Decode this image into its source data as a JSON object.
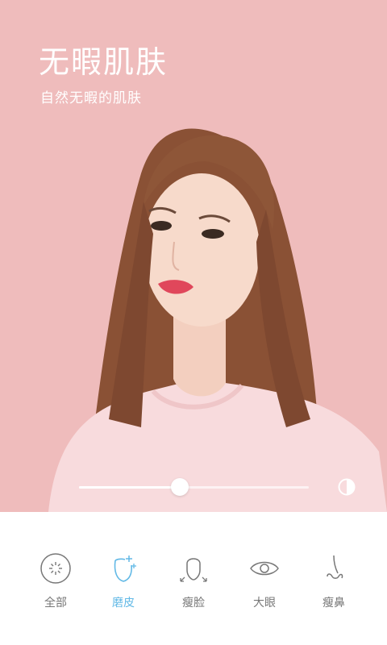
{
  "promo": {
    "title": "无暇肌肤",
    "subtitle": "自然无暇的肌肤"
  },
  "slider": {
    "value": 0.44
  },
  "toolbar": {
    "items": [
      {
        "label": "全部",
        "icon": "all-sparkle-icon",
        "active": false
      },
      {
        "label": "磨皮",
        "icon": "smooth-skin-icon",
        "active": true
      },
      {
        "label": "瘦脸",
        "icon": "slim-face-icon",
        "active": false
      },
      {
        "label": "大眼",
        "icon": "eye-icon",
        "active": false
      },
      {
        "label": "瘦鼻",
        "icon": "nose-icon",
        "active": false
      }
    ]
  },
  "colors": {
    "background": "#efbcbc",
    "accent": "#62b9e6",
    "inactive": "#777777"
  }
}
